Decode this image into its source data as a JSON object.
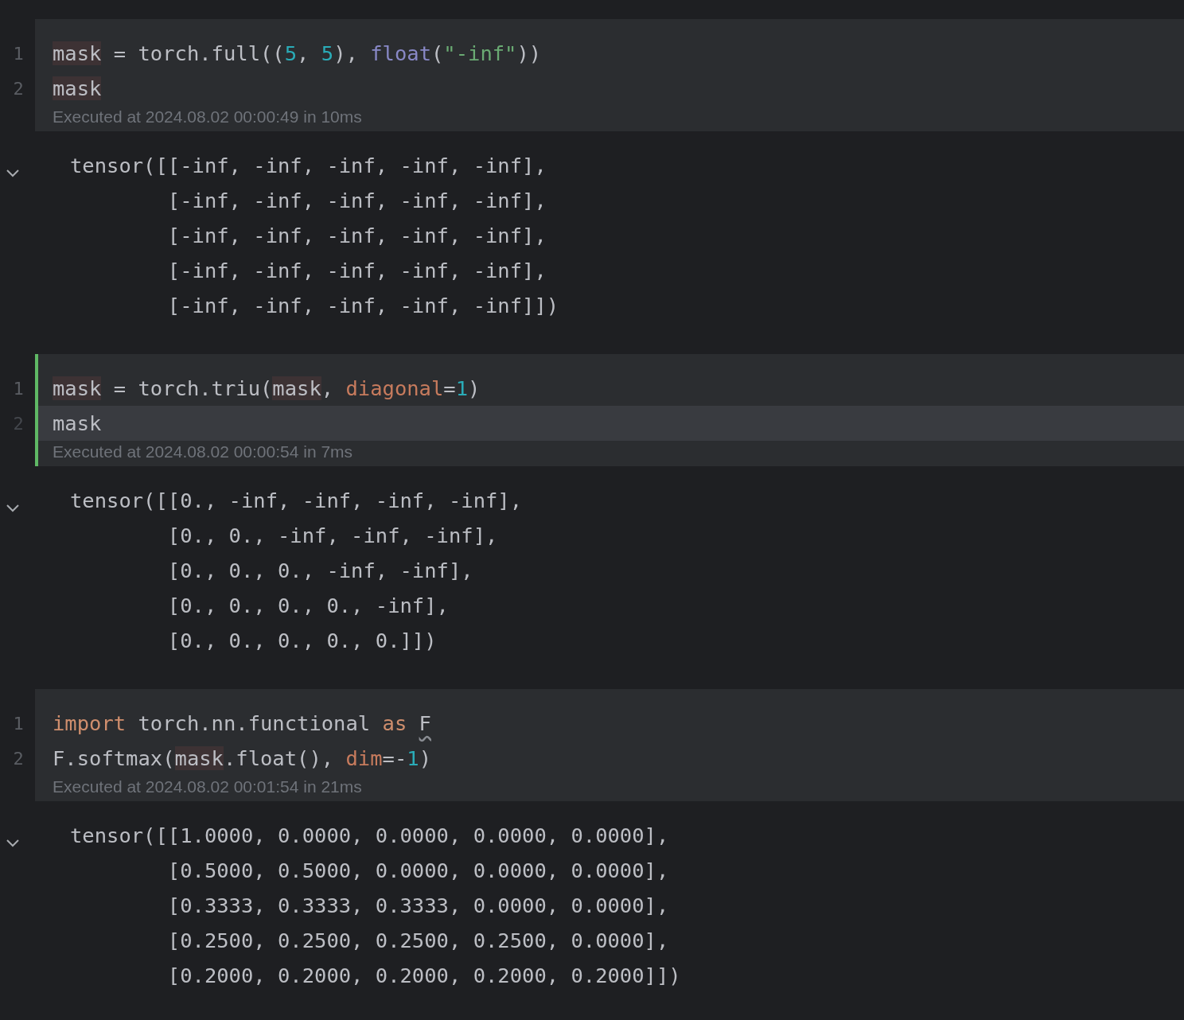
{
  "cells": [
    {
      "selected": false,
      "lines": [
        {
          "number": "1",
          "current": false,
          "tokens": [
            {
              "kind": "var",
              "text": "mask"
            },
            {
              "kind": "plain",
              "text": " = torch.full(("
            },
            {
              "kind": "num",
              "text": "5"
            },
            {
              "kind": "plain",
              "text": ", "
            },
            {
              "kind": "num",
              "text": "5"
            },
            {
              "kind": "plain",
              "text": "), "
            },
            {
              "kind": "builtin",
              "text": "float"
            },
            {
              "kind": "plain",
              "text": "("
            },
            {
              "kind": "str",
              "text": "\"-inf\""
            },
            {
              "kind": "plain",
              "text": "))"
            }
          ]
        },
        {
          "number": "2",
          "current": false,
          "tokens": [
            {
              "kind": "var",
              "text": "mask"
            }
          ]
        }
      ],
      "execution": "Executed at 2024.08.02 00:00:49 in 10ms",
      "output": {
        "expanded": true,
        "lines": [
          "tensor([[-inf, -inf, -inf, -inf, -inf],",
          "        [-inf, -inf, -inf, -inf, -inf],",
          "        [-inf, -inf, -inf, -inf, -inf],",
          "        [-inf, -inf, -inf, -inf, -inf],",
          "        [-inf, -inf, -inf, -inf, -inf]])"
        ]
      }
    },
    {
      "selected": true,
      "lines": [
        {
          "number": "1",
          "current": false,
          "tokens": [
            {
              "kind": "var",
              "text": "mask"
            },
            {
              "kind": "plain",
              "text": " = torch.triu("
            },
            {
              "kind": "var",
              "text": "mask"
            },
            {
              "kind": "plain",
              "text": ", "
            },
            {
              "kind": "param",
              "text": "diagonal"
            },
            {
              "kind": "plain",
              "text": "="
            },
            {
              "kind": "num",
              "text": "1"
            },
            {
              "kind": "plain",
              "text": ")"
            }
          ]
        },
        {
          "number": "2",
          "current": true,
          "tokens": [
            {
              "kind": "plain",
              "text": "mask"
            }
          ]
        }
      ],
      "execution": "Executed at 2024.08.02 00:00:54 in 7ms",
      "output": {
        "expanded": true,
        "lines": [
          "tensor([[0., -inf, -inf, -inf, -inf],",
          "        [0., 0., -inf, -inf, -inf],",
          "        [0., 0., 0., -inf, -inf],",
          "        [0., 0., 0., 0., -inf],",
          "        [0., 0., 0., 0., 0.]])"
        ]
      }
    },
    {
      "selected": false,
      "lines": [
        {
          "number": "1",
          "current": false,
          "tokens": [
            {
              "kind": "kw",
              "text": "import"
            },
            {
              "kind": "plain",
              "text": " torch.nn.functional "
            },
            {
              "kind": "kw",
              "text": "as "
            },
            {
              "kind": "warn",
              "text": "F"
            }
          ]
        },
        {
          "number": "2",
          "current": false,
          "tokens": [
            {
              "kind": "plain",
              "text": "F.softmax("
            },
            {
              "kind": "var",
              "text": "mask"
            },
            {
              "kind": "plain",
              "text": ".float(), "
            },
            {
              "kind": "param",
              "text": "dim"
            },
            {
              "kind": "plain",
              "text": "=-"
            },
            {
              "kind": "num",
              "text": "1"
            },
            {
              "kind": "plain",
              "text": ")"
            }
          ]
        }
      ],
      "execution": "Executed at 2024.08.02 00:01:54 in 21ms",
      "output": {
        "expanded": true,
        "lines": [
          "tensor([[1.0000, 0.0000, 0.0000, 0.0000, 0.0000],",
          "        [0.5000, 0.5000, 0.0000, 0.0000, 0.0000],",
          "        [0.3333, 0.3333, 0.3333, 0.0000, 0.0000],",
          "        [0.2500, 0.2500, 0.2500, 0.2500, 0.0000],",
          "        [0.2000, 0.2000, 0.2000, 0.2000, 0.2000]])"
        ]
      }
    }
  ]
}
